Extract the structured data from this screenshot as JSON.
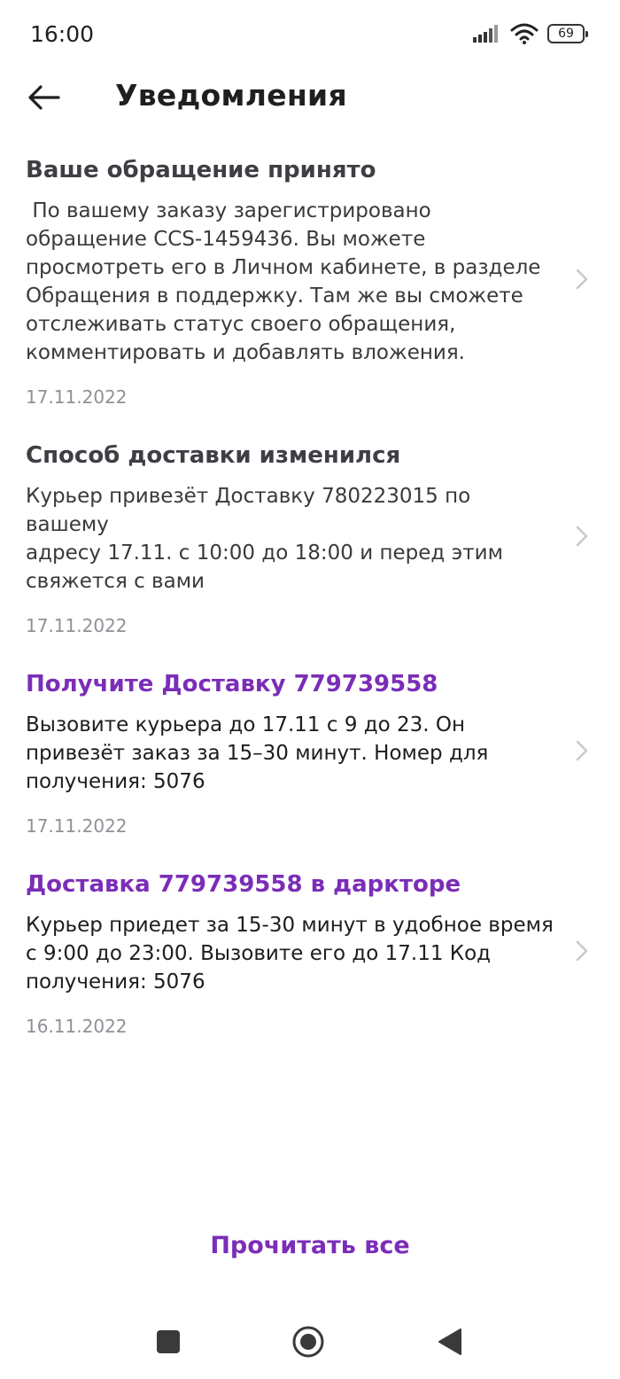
{
  "status_bar": {
    "time": "16:00",
    "battery": "69"
  },
  "header": {
    "title": "Уведомления"
  },
  "notifications": [
    {
      "title": "Ваше обращение принято",
      "body": " По вашему заказу зарегистрировано\nобращение CCS-1459436. Вы можете\nпросмотреть его в Личном кабинете, в разделе\nОбращения в поддержку. Там же вы сможете\nотслеживать статус своего обращения,\nкомментировать и добавлять вложения.",
      "date": "17.11.2022"
    },
    {
      "title": "Способ доставки изменился",
      "body": "Курьер привезёт Доставку 780223015 по вашему\nадресу 17.11. с 10:00 до 18:00 и перед этим\nсвяжется с вами",
      "date": "17.11.2022"
    },
    {
      "title": "Получите Доставку 779739558",
      "body": "Вызовите курьера до 17.11 с 9 до 23. Он\nпривезёт заказ за 15–30 минут. Номер для\nполучения: 5076",
      "date": "17.11.2022"
    },
    {
      "title": "Доставка 779739558 в даркторе",
      "body": "Курьер приедет за 15-30 минут в удобное время\nс 9:00 до 23:00. Вызовите его до 17.11 Код\nполучения: 5076",
      "date": "16.11.2022"
    }
  ],
  "actions": {
    "read_all": "Прочитать все"
  },
  "colors": {
    "accent": "#7b2db8",
    "title_dark": "#3d3f45",
    "date_gray": "#8e9197"
  }
}
